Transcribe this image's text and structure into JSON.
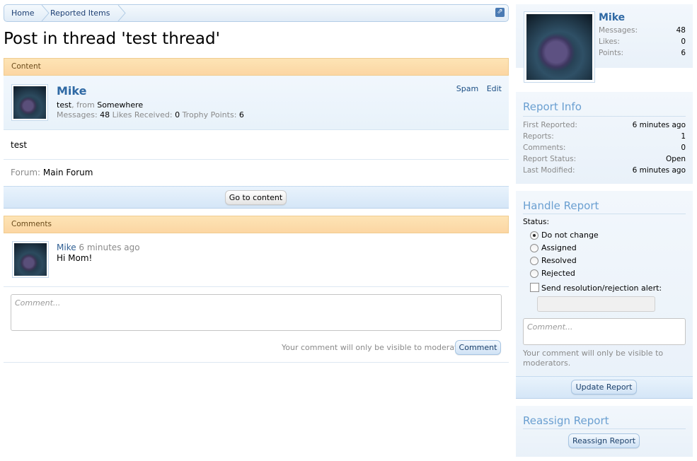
{
  "breadcrumb": {
    "home": "Home",
    "reported": "Reported Items"
  },
  "page_title": "Post in thread 'test thread'",
  "content_section": {
    "header": "Content",
    "poster": {
      "name": "Mike",
      "title": "test",
      "from_label": ", from",
      "location": "Somewhere",
      "messages_label": "Messages:",
      "messages": "48",
      "likes_label": "Likes Received:",
      "likes": "0",
      "trophy_label": "Trophy Points:",
      "trophy": "6",
      "spam": "Spam",
      "edit": "Edit"
    },
    "body": "test",
    "forum_label": "Forum:",
    "forum_name": "Main Forum",
    "goto_button": "Go to content"
  },
  "comments_section": {
    "header": "Comments",
    "comment": {
      "author": "Mike",
      "time": "6 minutes ago",
      "text": "Hi Mom!"
    },
    "input_placeholder": "Comment...",
    "hint": "Your comment will only be visible to moderators.",
    "submit": "Comment"
  },
  "sidebar": {
    "profile": {
      "name": "Mike",
      "rows": [
        {
          "k": "Messages:",
          "v": "48"
        },
        {
          "k": "Likes:",
          "v": "0"
        },
        {
          "k": "Points:",
          "v": "6"
        }
      ]
    },
    "report_info": {
      "title": "Report Info",
      "rows": [
        {
          "k": "First Reported:",
          "v": "6 minutes ago"
        },
        {
          "k": "Reports:",
          "v": "1"
        },
        {
          "k": "Comments:",
          "v": "0"
        },
        {
          "k": "Report Status:",
          "v": "Open"
        },
        {
          "k": "Last Modified:",
          "v": "6 minutes ago"
        }
      ]
    },
    "handle": {
      "title": "Handle Report",
      "status_label": "Status:",
      "options": [
        "Do not change",
        "Assigned",
        "Resolved",
        "Rejected"
      ],
      "selected": "Do not change",
      "alert_label": "Send resolution/rejection alert:",
      "comment_placeholder": "Comment...",
      "hint": "Your comment will only be visible to moderators.",
      "update_button": "Update Report"
    },
    "reassign": {
      "title": "Reassign Report",
      "button": "Reassign Report"
    }
  },
  "colors": {
    "accent": "#2f69a4",
    "section_header": "#fcd6a3",
    "sidebar_title": "#6a9fd1"
  }
}
